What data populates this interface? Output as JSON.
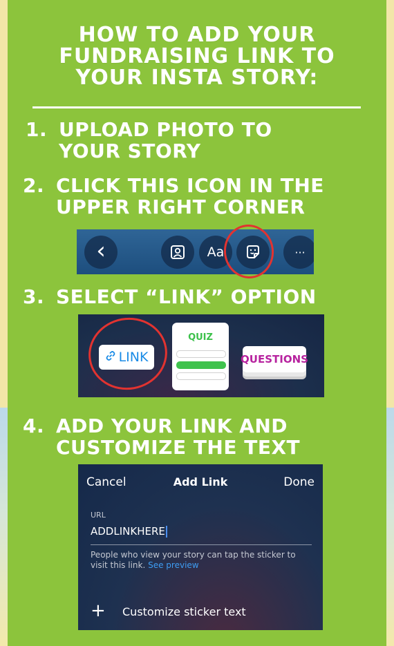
{
  "title_lines": [
    "HOW TO ADD YOUR",
    "FUNDRAISING LINK TO",
    "YOUR INSTA STORY:"
  ],
  "steps": [
    {
      "num": "1.",
      "line1": "UPLOAD PHOTO TO",
      "line2": "YOUR STORY"
    },
    {
      "num": "2.",
      "line1": "CLICK THIS ICON IN THE",
      "line2": "UPPER RIGHT CORNER"
    },
    {
      "num": "3.",
      "line1": "SELECT “LINK” OPTION",
      "line2": ""
    },
    {
      "num": "4.",
      "line1": "ADD YOUR LINK AND",
      "line2": "CUSTOMIZE THE TEXT"
    }
  ],
  "toolbar": {
    "back_glyph": "‹",
    "text_glyph": "Aa",
    "more_glyph": "···"
  },
  "stickers": {
    "link_label": "LINK",
    "quiz_label": "QUIZ",
    "questions_label": "QUESTIONS"
  },
  "add_link": {
    "cancel": "Cancel",
    "title": "Add Link",
    "done": "Done",
    "url_label": "URL",
    "url_value": "ADDLINKHERE",
    "help_text": "People who view your story can tap the sticker to visit this link. ",
    "preview_link": "See preview",
    "plus_glyph": "+",
    "customize": "Customize sticker text"
  },
  "colors": {
    "panel_green": "#8cc43c",
    "highlight_red": "#e23330",
    "link_blue": "#1a8be6",
    "quiz_green": "#3cc14b",
    "questions_magenta": "#b7239f"
  }
}
